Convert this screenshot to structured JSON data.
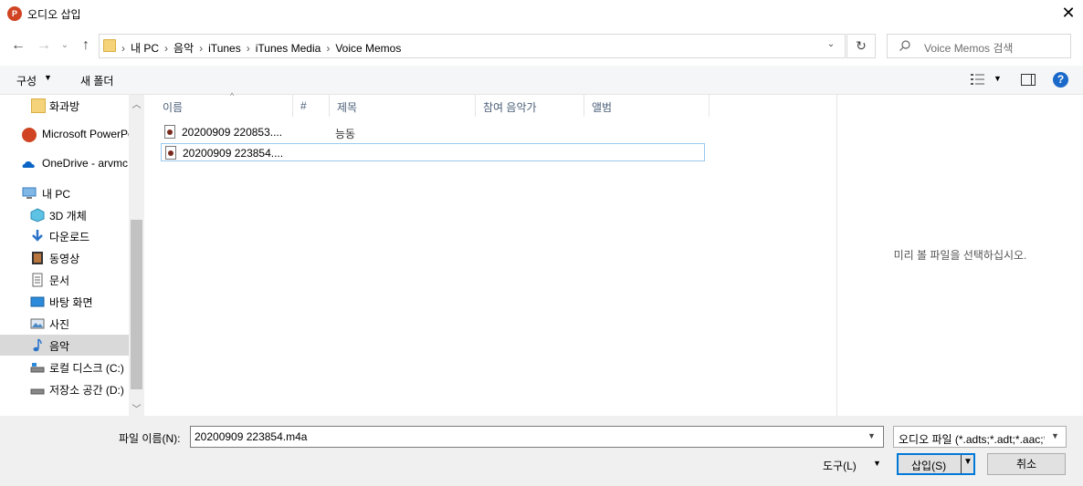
{
  "window": {
    "title": "오디오 삽입",
    "app_icon_letter": "P",
    "close_glyph": "✕"
  },
  "nav_buttons": {
    "back": "←",
    "forward": "→",
    "recent": "⌄",
    "up": "↑"
  },
  "address": {
    "breadcrumbs": [
      "내 PC",
      "음악",
      "iTunes",
      "iTunes Media",
      "Voice Memos"
    ],
    "separator": "›",
    "dropdown_glyph": "⌄",
    "refresh_glyph": "↻"
  },
  "search": {
    "placeholder": "Voice Memos 검색"
  },
  "toolbar": {
    "organize": "구성",
    "new_folder": "새 폴더",
    "help": "?"
  },
  "nav_pane": {
    "items": [
      {
        "label": "화과방",
        "icon": "folder-icon"
      },
      {
        "label": "Microsoft PowerPoint",
        "icon": "powerpoint-icon"
      },
      {
        "label": "OneDrive - arvmc",
        "icon": "onedrive-icon"
      },
      {
        "label": "내 PC",
        "icon": "pc-icon"
      },
      {
        "label": "3D 개체",
        "icon": "3d-objects-icon"
      },
      {
        "label": "다운로드",
        "icon": "download-icon"
      },
      {
        "label": "동영상",
        "icon": "video-icon"
      },
      {
        "label": "문서",
        "icon": "document-icon"
      },
      {
        "label": "바탕 화면",
        "icon": "desktop-icon"
      },
      {
        "label": "사진",
        "icon": "pictures-icon"
      },
      {
        "label": "음악",
        "icon": "music-icon",
        "selected": true
      },
      {
        "label": "로컬 디스크 (C:)",
        "icon": "drive-icon"
      },
      {
        "label": "저장소 공간 (D:)",
        "icon": "drive-icon"
      }
    ]
  },
  "file_list": {
    "columns": [
      "이름",
      "#",
      "제목",
      "참여 음악가",
      "앨범"
    ],
    "rows": [
      {
        "name": "20200909 220853....",
        "title": "능동"
      },
      {
        "name": "20200909 223854....",
        "title": ""
      }
    ]
  },
  "preview": {
    "message": "미리 볼 파일을 선택하십시오."
  },
  "bottom": {
    "filename_label": "파일 이름(N):",
    "filename_value": "20200909 223854.m4a",
    "filter": "오디오 파일 (*.adts;*.adt;*.aac;*",
    "tools": "도구(L)",
    "insert": "삽입(S)",
    "cancel": "취소"
  },
  "colors": {
    "accent": "#0078d7",
    "selection": "#d9d9d9",
    "powerpoint": "#d04423"
  }
}
